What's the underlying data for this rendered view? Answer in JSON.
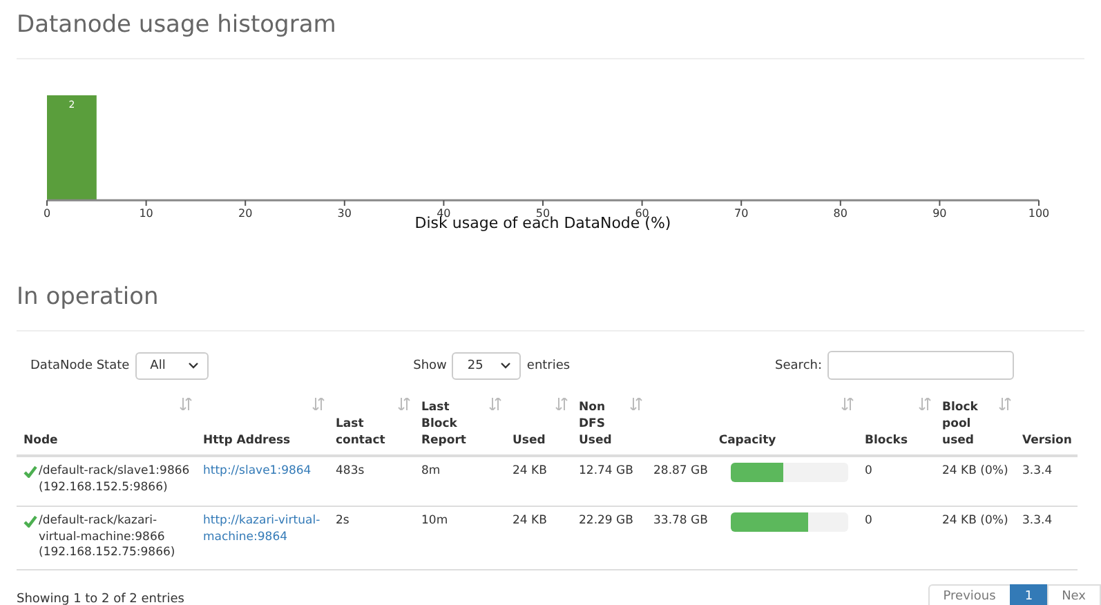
{
  "histogram": {
    "title": "Datanode usage histogram",
    "chart_data": {
      "type": "bar",
      "xlabel": "Disk usage of each DataNode (%)",
      "x": [
        2.5
      ],
      "values": [
        2
      ],
      "xlim": [
        0,
        100
      ],
      "xticks": [
        {
          "value": 0,
          "label": "0"
        },
        {
          "value": 10,
          "label": "10"
        },
        {
          "value": 20,
          "label": "20"
        },
        {
          "value": 30,
          "label": "30"
        },
        {
          "value": 40,
          "label": "40"
        },
        {
          "value": 50,
          "label": "50"
        },
        {
          "value": 60,
          "label": "60"
        },
        {
          "value": 70,
          "label": "70"
        },
        {
          "value": 80,
          "label": "80"
        },
        {
          "value": 90,
          "label": "90"
        },
        {
          "value": 100,
          "label": "100"
        }
      ],
      "data_labels": true
    }
  },
  "operation": {
    "title": "In operation",
    "state_filter": {
      "label": "DataNode State",
      "value": "All"
    },
    "page_size": {
      "before": "Show",
      "value": "25",
      "after": "entries"
    },
    "search": {
      "label": "Search:"
    },
    "columns": [
      {
        "label": "Node"
      },
      {
        "label": "Http Address"
      },
      {
        "label": "Last contact"
      },
      {
        "label": "Last Block Report"
      },
      {
        "label": "Used"
      },
      {
        "label": "Non DFS Used"
      },
      {
        "label": "Capacity"
      },
      {
        "label": "Blocks"
      },
      {
        "label": "Block pool used"
      },
      {
        "label": "Version"
      }
    ],
    "rows": [
      {
        "node": "/default-rack/slave1:9866 (192.168.152.5:9866)",
        "http": "http://slave1:9864",
        "last_contact": "483s",
        "last_block_report": "8m",
        "used": "24 KB",
        "non_dfs_used": "12.74 GB",
        "capacity": "28.87 GB",
        "level": 0.45,
        "blocks": "0",
        "block_pool_used": "24 KB (0%)",
        "version": "3.3.4"
      },
      {
        "node": "/default-rack/kazari-virtual-machine:9866 (192.168.152.75:9866)",
        "http": "http://kazari-virtual-machine:9864",
        "last_contact": "2s",
        "last_block_report": "10m",
        "used": "24 KB",
        "non_dfs_used": "22.29 GB",
        "capacity": "33.78 GB",
        "level": 0.66,
        "blocks": "0",
        "block_pool_used": "24 KB (0%)",
        "version": "3.3.4"
      }
    ],
    "info": "Showing 1 to 2 of 2 entries",
    "pagination": [
      {
        "label": "Previous",
        "selected": false
      },
      {
        "label": "1",
        "selected": true
      },
      {
        "label": "Nex",
        "selected": false
      }
    ]
  }
}
